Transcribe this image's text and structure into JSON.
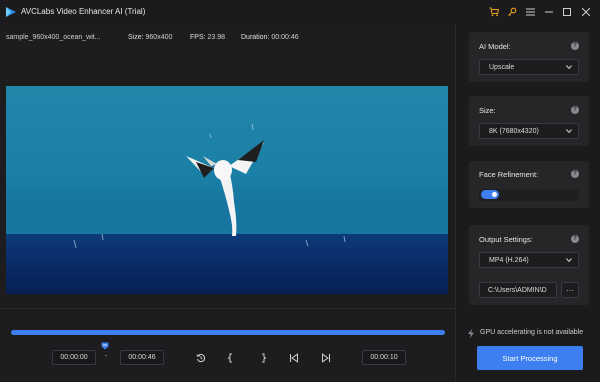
{
  "app": {
    "title": "AVCLabs Video Enhancer AI (Trial)"
  },
  "file_info": {
    "filename": "sample_960x400_ocean_wit...",
    "size_label": "Size:",
    "size_value": "960x400",
    "fps_label": "FPS:",
    "fps_value": "23.98",
    "duration_label": "Duration:",
    "duration_value": "00:00:46"
  },
  "timeline": {
    "progress": 1.0,
    "marker_fraction": 0.22
  },
  "times": {
    "start": "00:00:00",
    "dash": "-",
    "end": "00:00:46",
    "current": "00:00:10"
  },
  "settings": {
    "ai_model_label": "AI Model:",
    "ai_model_value": "Upscale",
    "size_label": "Size:",
    "size_value": "8K (7680x4320)",
    "face_label": "Face Refinement:",
    "face_enabled": true,
    "output_label": "Output Settings:",
    "format_value": "MP4 (H.264)",
    "path_value": "C:\\Users\\ADMIN\\D",
    "more_label": "···"
  },
  "gpu_status": "GPU accelerating is not available",
  "start_button": "Start Processing",
  "colors": {
    "accent": "#3d7ff0",
    "cart": "#e8a21a",
    "key": "#e8a21a"
  }
}
